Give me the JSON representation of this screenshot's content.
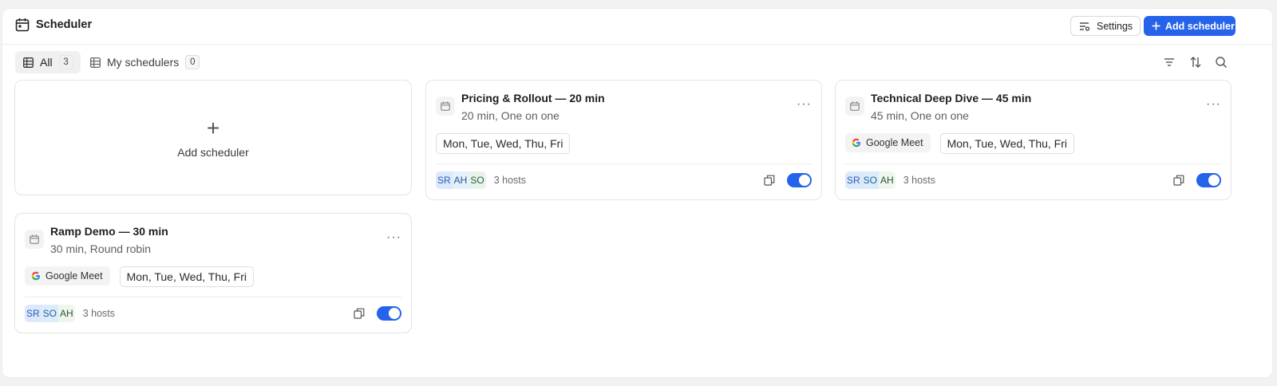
{
  "header": {
    "title": "Scheduler",
    "settings_label": "Settings",
    "add_label": "Add scheduler"
  },
  "tabs": [
    {
      "label": "All",
      "count": "3",
      "active": true
    },
    {
      "label": "My schedulers",
      "count": "0",
      "active": false
    }
  ],
  "toolbar_icons": [
    "filter-icon",
    "sort-icon",
    "search-icon"
  ],
  "add_card": {
    "label": "Add scheduler",
    "icon": "plus-icon"
  },
  "cards": [
    {
      "title": "Pricing & Rollout — 20 min",
      "subtitle": "20 min, One on one",
      "meet": null,
      "days": "Mon, Tue, Wed, Thu, Fri",
      "hosts": [
        "SR",
        "AH",
        "SO"
      ],
      "hosts_label": "3 hosts",
      "enabled": true
    },
    {
      "title": "Technical Deep Dive — 45 min",
      "subtitle": "45 min, One on one",
      "meet": "Google Meet",
      "days": "Mon, Tue, Wed, Thu, Fri",
      "hosts": [
        "SR",
        "SO",
        "AH"
      ],
      "hosts_label": "3 hosts",
      "enabled": true
    },
    {
      "title": "Ramp Demo — 30 min",
      "subtitle": "30 min, Round robin",
      "meet": "Google Meet",
      "days": "Mon, Tue, Wed, Thu, Fri",
      "hosts": [
        "SR",
        "SO",
        "AH"
      ],
      "hosts_label": "3 hosts",
      "enabled": true
    }
  ],
  "colors": {
    "accent": "#2563eb",
    "border": "#e4e4e4",
    "muted_text": "#6b6b6b"
  }
}
